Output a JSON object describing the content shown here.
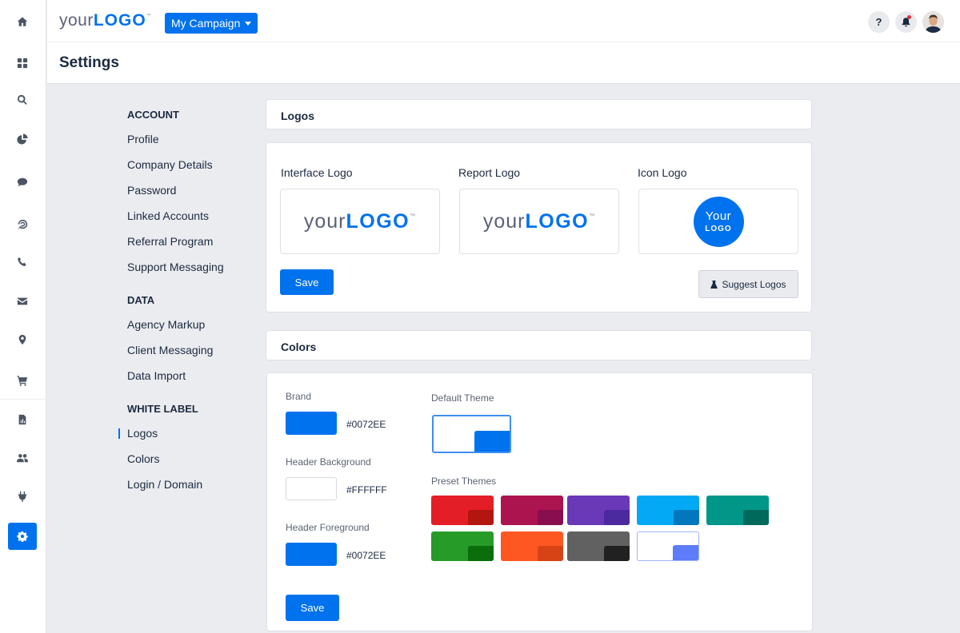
{
  "header": {
    "logo_your": "your",
    "logo_logo": "LOGO",
    "logo_tm": "™",
    "campaign_label": "My Campaign",
    "help_label": "?"
  },
  "rail": {
    "items": [
      {
        "icon": "home-icon"
      },
      {
        "icon": "dashboard-icon"
      },
      {
        "icon": "search-icon"
      },
      {
        "icon": "pie-chart-icon"
      },
      {
        "icon": "chat-icon"
      },
      {
        "icon": "target-icon"
      },
      {
        "icon": "phone-icon"
      },
      {
        "icon": "mail-icon"
      },
      {
        "icon": "map-pin-icon"
      },
      {
        "icon": "cart-icon"
      },
      {
        "icon": "report-icon"
      },
      {
        "icon": "users-icon"
      },
      {
        "icon": "plug-icon"
      },
      {
        "icon": "gear-icon",
        "active": true
      }
    ]
  },
  "page": {
    "title": "Settings"
  },
  "settings_nav": {
    "groups": [
      {
        "heading": "ACCOUNT",
        "items": [
          "Profile",
          "Company Details",
          "Password",
          "Linked Accounts",
          "Referral Program",
          "Support Messaging"
        ]
      },
      {
        "heading": "DATA",
        "items": [
          "Agency Markup",
          "Client Messaging",
          "Data Import"
        ]
      },
      {
        "heading": "WHITE LABEL",
        "items": [
          "Logos",
          "Colors",
          "Login / Domain"
        ]
      }
    ],
    "active": "Logos"
  },
  "logos": {
    "title": "Logos",
    "interface_label": "Interface Logo",
    "report_label": "Report Logo",
    "icon_label": "Icon Logo",
    "wordmark_your": "your",
    "wordmark_logo": "LOGO",
    "wordmark_tm": "™",
    "icon_line1": "Your",
    "icon_line2": "LOGO",
    "save_label": "Save",
    "suggest_label": "Suggest Logos"
  },
  "colors": {
    "title": "Colors",
    "brand_label": "Brand",
    "brand_value": "#0072EE",
    "header_bg_label": "Header Background",
    "header_bg_value": "#FFFFFF",
    "header_fg_label": "Header Foreground",
    "header_fg_value": "#0072EE",
    "default_theme_label": "Default Theme",
    "preset_themes_label": "Preset Themes",
    "save_label": "Save",
    "presets": [
      {
        "name": "red",
        "main": "#e41e26",
        "corner": "#b3150f"
      },
      {
        "name": "crimson",
        "main": "#ab144f",
        "corner": "#880e4f"
      },
      {
        "name": "purple",
        "main": "#6a39b8",
        "corner": "#4a2a9e"
      },
      {
        "name": "sky",
        "main": "#03a9f4",
        "corner": "#0277bd"
      },
      {
        "name": "teal",
        "main": "#009688",
        "corner": "#00695c"
      },
      {
        "name": "green",
        "main": "#279b27",
        "corner": "#0a6e0a"
      },
      {
        "name": "orange",
        "main": "#ff5722",
        "corner": "#d84315"
      },
      {
        "name": "gray",
        "main": "#616161",
        "corner": "#212121"
      },
      {
        "name": "white-indigo",
        "main": "#ffffff",
        "corner": "#5c7cfa",
        "outlined": "#9fb3fb"
      }
    ]
  }
}
